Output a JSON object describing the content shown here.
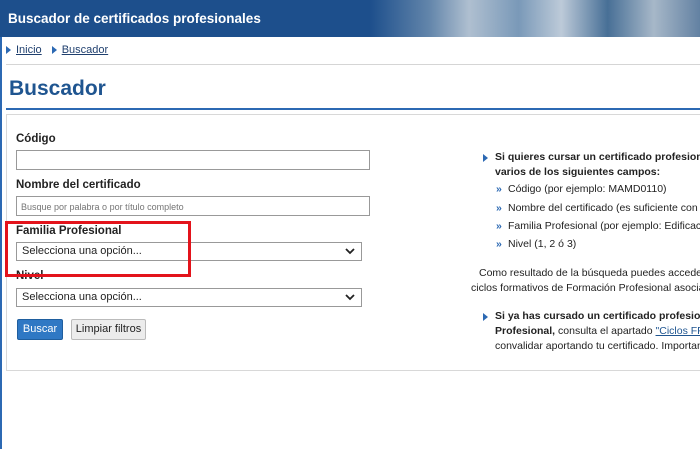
{
  "header": {
    "title": "Buscador de certificados profesionales"
  },
  "breadcrumb": {
    "items": [
      "Inicio",
      "Buscador"
    ]
  },
  "page": {
    "title": "Buscador"
  },
  "form": {
    "codigo": {
      "label": "Código",
      "value": "",
      "placeholder": ""
    },
    "nombre": {
      "label": "Nombre del certificado",
      "value": "",
      "placeholder": "Busque por palabra o por título completo"
    },
    "familia": {
      "label": "Familia Profesional",
      "selected": "Selecciona una opción..."
    },
    "nivel": {
      "label": "Nivel",
      "selected": "Selecciona una opción..."
    },
    "buttons": {
      "search": "Buscar",
      "clear": "Limpiar filtros"
    }
  },
  "info": {
    "p1_line1": "Si quieres cursar un certificado profesion",
    "p1_line2": "varios de los siguientes campos:",
    "bullets": [
      "Código (por ejemplo: MAMD0110)",
      "Nombre del certificado (es suficiente con",
      "Familia Profesional (por ejemplo: Edificac",
      "Nivel (1, 2 ó 3)"
    ],
    "p2_line1": "Como resultado de la búsqueda puedes acceder",
    "p2_line2": "ciclos formativos de Formación Profesional asocia",
    "p3_line1": "Si ya has cursado un certificado profesio",
    "p3_line2_bold": "Profesional,",
    "p3_line2_text": " consulta el apartado ",
    "p3_line2_link": "\"Ciclos FF",
    "p3_line3": "convalidar aportando tu certificado. Importan"
  },
  "colors": {
    "header_bg": "#1d4f8c",
    "accent": "#2c69b3",
    "highlight": "#e3131b",
    "primary_button": "#2f78c4"
  }
}
